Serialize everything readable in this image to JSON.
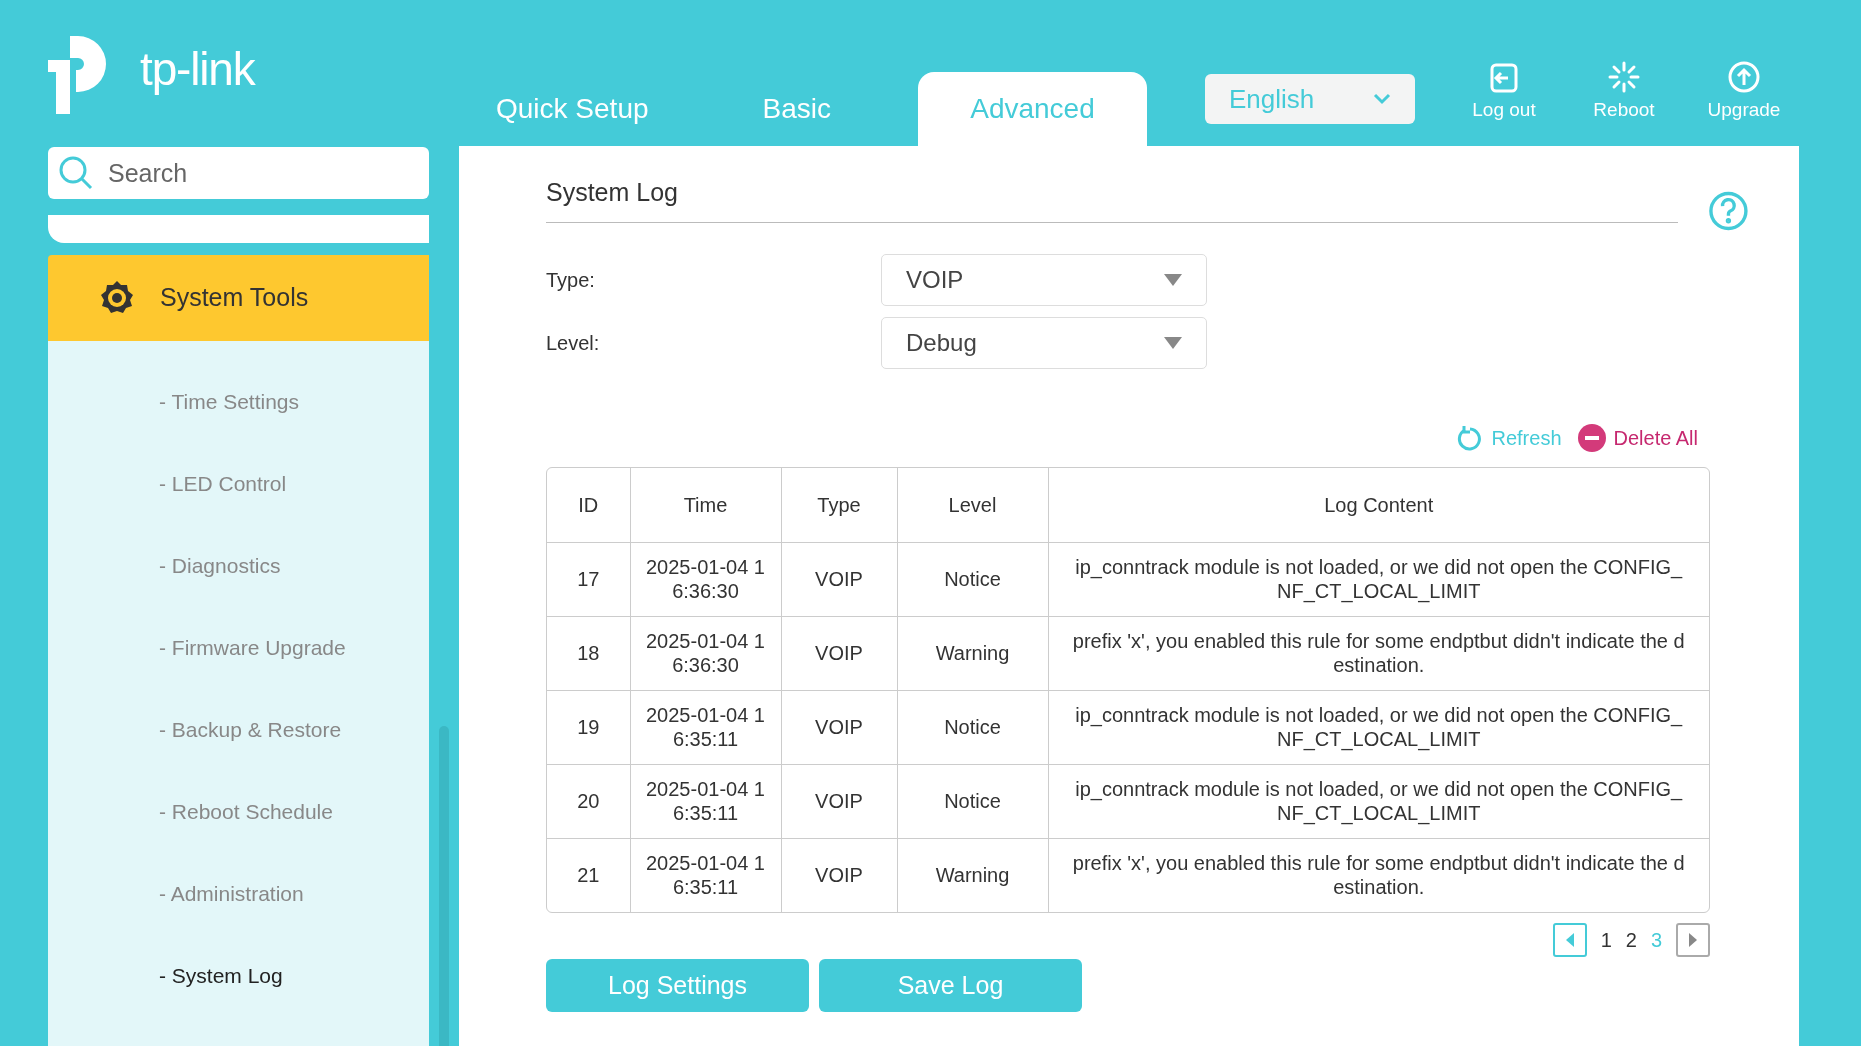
{
  "brand": {
    "name": "tp-link"
  },
  "tabs": [
    {
      "label": "Quick Setup",
      "selected": false
    },
    {
      "label": "Basic",
      "selected": false
    },
    {
      "label": "Advanced",
      "selected": true
    }
  ],
  "language": {
    "value": "English"
  },
  "header_actions": [
    {
      "kind": "logout",
      "label": "Log out"
    },
    {
      "kind": "reboot",
      "label": "Reboot"
    },
    {
      "kind": "upgrade",
      "label": "Upgrade"
    }
  ],
  "search": {
    "placeholder": "Search"
  },
  "sidebar": {
    "section": {
      "label": "System Tools",
      "selected": true
    },
    "items": [
      {
        "label": "- Time Settings",
        "selected": false
      },
      {
        "label": "- LED Control",
        "selected": false
      },
      {
        "label": "- Diagnostics",
        "selected": false
      },
      {
        "label": "- Firmware Upgrade",
        "selected": false
      },
      {
        "label": "- Backup & Restore",
        "selected": false
      },
      {
        "label": "- Reboot Schedule",
        "selected": false
      },
      {
        "label": "- Administration",
        "selected": false
      },
      {
        "label": "- System Log",
        "selected": true
      }
    ]
  },
  "page": {
    "title": "System Log",
    "filters": [
      {
        "label": "Type:",
        "value": "VOIP"
      },
      {
        "label": "Level:",
        "value": "Debug"
      }
    ],
    "actions": [
      {
        "kind": "refresh",
        "label": "Refresh"
      },
      {
        "kind": "delete",
        "label": "Delete All"
      }
    ],
    "table": {
      "columns": [
        "ID",
        "Time",
        "Type",
        "Level",
        "Log Content"
      ],
      "rows": [
        [
          "17",
          "2025-01-04 16:36:30",
          "VOIP",
          "Notice",
          "ip_conntrack module is not loaded, or we did not open the CONFIG_NF_CT_LOCAL_LIMIT"
        ],
        [
          "18",
          "2025-01-04 16:36:30",
          "VOIP",
          "Warning",
          "prefix 'x', you enabled this rule for some endptbut didn't indicate the destination."
        ],
        [
          "19",
          "2025-01-04 16:35:11",
          "VOIP",
          "Notice",
          "ip_conntrack module is not loaded, or we did not open the CONFIG_NF_CT_LOCAL_LIMIT"
        ],
        [
          "20",
          "2025-01-04 16:35:11",
          "VOIP",
          "Notice",
          "ip_conntrack module is not loaded, or we did not open the CONFIG_NF_CT_LOCAL_LIMIT"
        ],
        [
          "21",
          "2025-01-04 16:35:11",
          "VOIP",
          "Warning",
          "prefix 'x', you enabled this rule for some endptbut didn't indicate the destination."
        ]
      ]
    },
    "pagination": [
      {
        "label": "1",
        "selected": false
      },
      {
        "label": "2",
        "selected": false
      },
      {
        "label": "3",
        "selected": true
      }
    ],
    "buttons": [
      "Log Settings",
      "Save Log"
    ]
  }
}
